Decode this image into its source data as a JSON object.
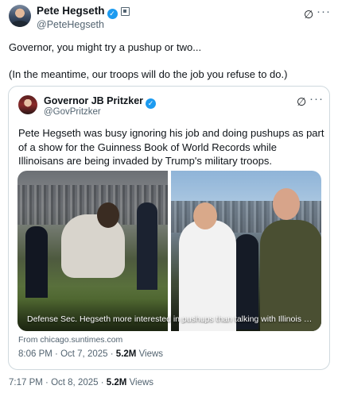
{
  "post": {
    "author_name": "Pete Hegseth",
    "author_handle": "@PeteHegseth",
    "line1": "Governor, you might try a pushup or two...",
    "line2": "(In the meantime, our troops will do the job you refuse to do.)",
    "time": "7:17 PM",
    "date": "Oct 8, 2025",
    "views_count": "5.2M",
    "views_label": "Views"
  },
  "quote": {
    "author_name": "Governor JB Pritzker",
    "author_handle": "@GovPritzker",
    "text": "Pete Hegseth was busy ignoring his job and doing pushups as part of a show for the Guinness Book of World Records while Illinoisans are being invaded by Trump's military troops.",
    "card_caption": "Defense Sec. Hegseth more interested in pushups than talking with Illinois leaders, Pri...",
    "source": "From chicago.suntimes.com",
    "time": "8:06 PM",
    "date": "Oct 7, 2025",
    "views_count": "5.2M",
    "views_label": "Views"
  },
  "icons": {
    "verified": "✓",
    "grok": "∅",
    "more": "···",
    "dot": "·"
  },
  "colors": {
    "text_primary": "#0f1419",
    "text_secondary": "#536471",
    "verified_blue": "#1d9bf0",
    "border": "#cfd9de"
  }
}
